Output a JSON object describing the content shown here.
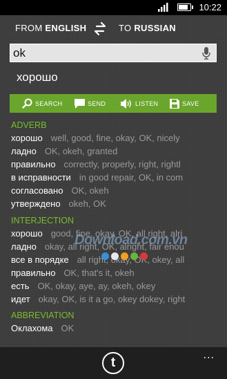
{
  "status_bar": {
    "time": "10:22"
  },
  "lang": {
    "from_prefix": "FROM",
    "from_lang": "ENGLISH",
    "to_prefix": "TO",
    "to_lang": "RUSSIAN"
  },
  "search": {
    "value": "ok"
  },
  "translation": "хорошо",
  "actions": {
    "search": "SEARCH",
    "send": "SEND",
    "listen": "LISTEN",
    "save": "SAVE"
  },
  "sections": [
    {
      "header": "ADVERB",
      "entries": [
        {
          "word": "хорошо",
          "meanings": "well, good, fine, okay, OK, nicely"
        },
        {
          "word": "ладно",
          "meanings": "OK, okeh, granted"
        },
        {
          "word": "правильно",
          "meanings": "correctly, properly, right, rightl"
        },
        {
          "word": "в исправности",
          "meanings": "in good repair, OK, in com"
        },
        {
          "word": "согласовано",
          "meanings": "OK, okeh"
        },
        {
          "word": "утверждено",
          "meanings": "okeh, OK"
        }
      ]
    },
    {
      "header": "INTERJECTION",
      "entries": [
        {
          "word": "хорошо",
          "meanings": "good, fine, okay, OK, all right, alri"
        },
        {
          "word": "ладно",
          "meanings": "okay, all right, OK, alright, fair enou"
        },
        {
          "word": "все в порядке",
          "meanings": "all right, okay, OK, okey, all"
        },
        {
          "word": "правильно",
          "meanings": "OK, that's it, okeh"
        },
        {
          "word": "есть",
          "meanings": "OK, okay, aye, ay, okeh, okey"
        },
        {
          "word": "идет",
          "meanings": "okay, OK, is it a go, okey dokey, right"
        }
      ]
    },
    {
      "header": "ABBREVIATION",
      "entries": [
        {
          "word": "Оклахома",
          "meanings": "OK"
        }
      ]
    }
  ],
  "watermark": "Download.com.vn",
  "app_bar": {
    "button_label": "t",
    "more": "..."
  },
  "colors": {
    "accent": "#6aa62c",
    "section_header": "#7cbd2e",
    "background": "#3b3b3b"
  }
}
